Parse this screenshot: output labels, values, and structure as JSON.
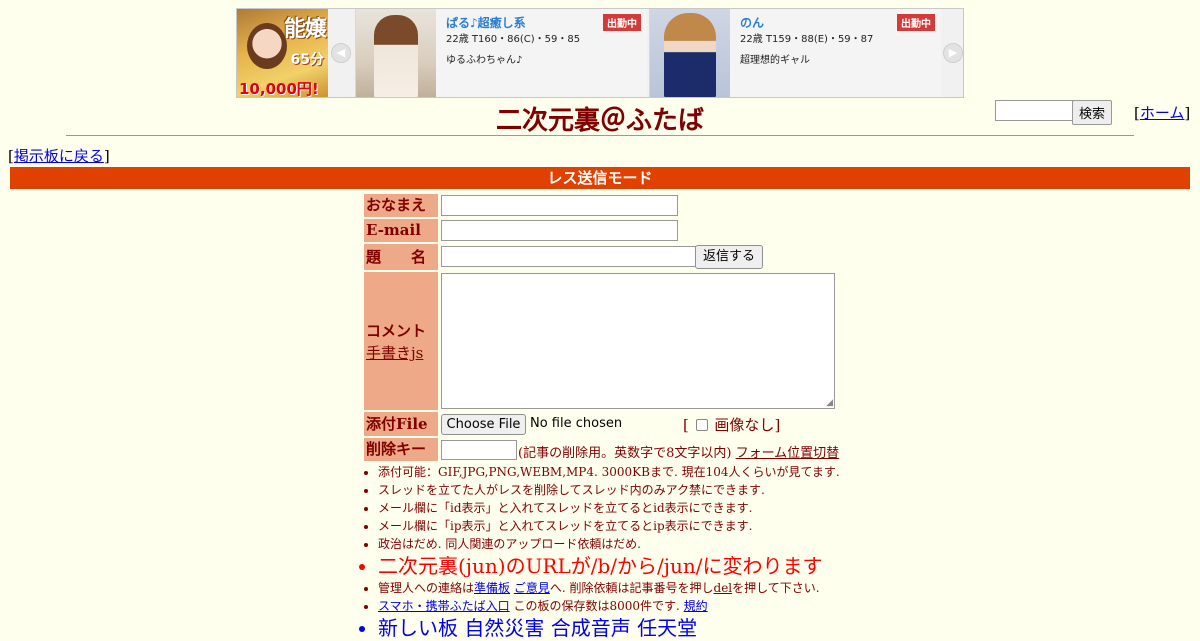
{
  "ad": {
    "logo": {
      "text1": "能嬢",
      "text2": "10,000円!",
      "text3": "65分"
    },
    "prev_arrow": "◀",
    "next_arrow": "▶",
    "cards": [
      {
        "name": "ぱる♪超癒し系",
        "badge": "出勤中",
        "stats": "22歳 T160・86(C)・59・85",
        "desc": "ゆるふわちゃん♪"
      },
      {
        "name": "のん",
        "badge": "出勤中",
        "stats": "22歳 T159・88(E)・59・87",
        "desc": "超理想的ギャル"
      }
    ]
  },
  "header": {
    "title": "二次元裏＠ふたば",
    "search_button": "検索",
    "home_open": "[",
    "home_link": "ホーム",
    "home_close": "]"
  },
  "nav": {
    "back_open": "[",
    "back_link": "掲示板に戻る",
    "back_close": "]"
  },
  "mode_label": "レス送信モード",
  "form": {
    "name_label": "おなまえ",
    "email_label": "E-mail",
    "subject_label": "題　　名",
    "submit_label": "返信する",
    "comment_label": "コメント",
    "handwriting_link": "手書きjs",
    "file_label": "添付File",
    "choose_file": "Choose File",
    "no_file": "No file chosen",
    "no_image_open": "[",
    "no_image_label": "画像なし",
    "no_image_close": "]",
    "delkey_label": "削除キー",
    "delkey_note": "(記事の削除用。英数字で8文字以内)",
    "form_position_link": "フォーム位置切替"
  },
  "notes": {
    "n1": "添付可能：GIF,JPG,PNG,WEBM,MP4. 3000KBまで. 現在104人くらいが見てます.",
    "n2": "スレッドを立てた人がレスを削除してスレッド内のみアク禁にできます.",
    "n3": "メール欄に「id表示」と入れてスレッドを立てるとid表示にできます.",
    "n4": "メール欄に「ip表示」と入れてスレッドを立てるとip表示にできます.",
    "n5": "政治はだめ. 同人関連のアップロード依頼はだめ.",
    "n6": "二次元裏(jun)のURLが/b/から/jun/に変わります",
    "n7_pre": "管理人への連絡は",
    "n7_link1": "準備板",
    "n7_link2": "ご意見",
    "n7_mid": "へ. 削除依頼は記事番号を押し",
    "n7_link3": "del",
    "n7_post": "を押して下さい.",
    "n8_link": "スマホ・携帯ふたば入口",
    "n8_mid": " この板の保存数は8000件です. ",
    "n8_link2": "規約",
    "n9": "新しい板 自然災害 合成音声 任天堂"
  },
  "colors": {
    "background": "#ffffee",
    "text": "#800000",
    "mode_bar": "#e04000",
    "label_bg": "#eeaa88",
    "link": "#0000ee"
  }
}
